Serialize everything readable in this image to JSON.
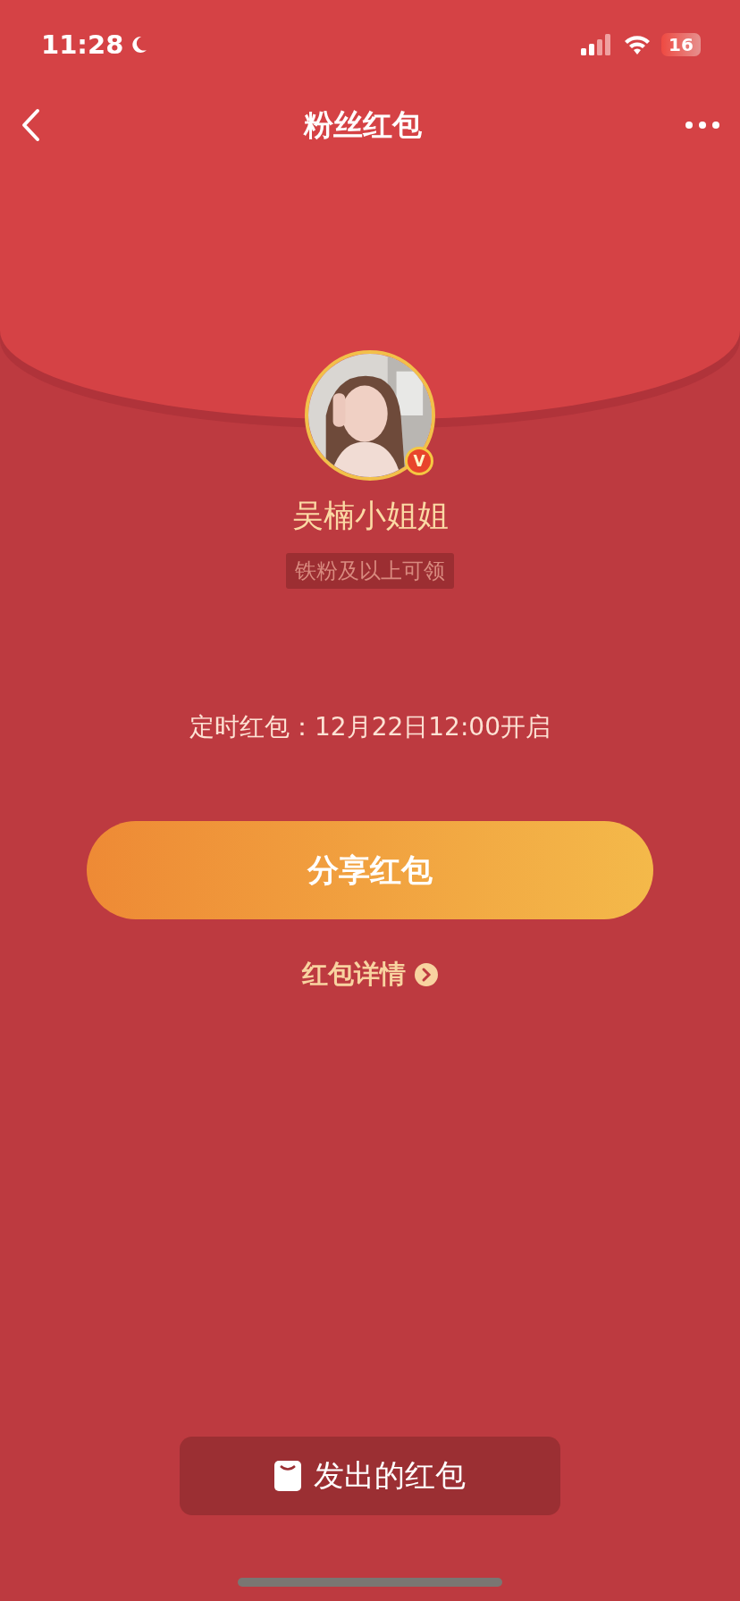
{
  "status_bar": {
    "time": "11:28",
    "battery": "16"
  },
  "nav": {
    "title": "粉丝红包"
  },
  "sender": {
    "verified_badge": "V",
    "name": "吴楠小姐姐",
    "requirement": "铁粉及以上可领"
  },
  "timer": "定时红包：12月22日12:00开启",
  "share_button": "分享红包",
  "details_link": "红包详情",
  "sent_button": "发出的红包"
}
